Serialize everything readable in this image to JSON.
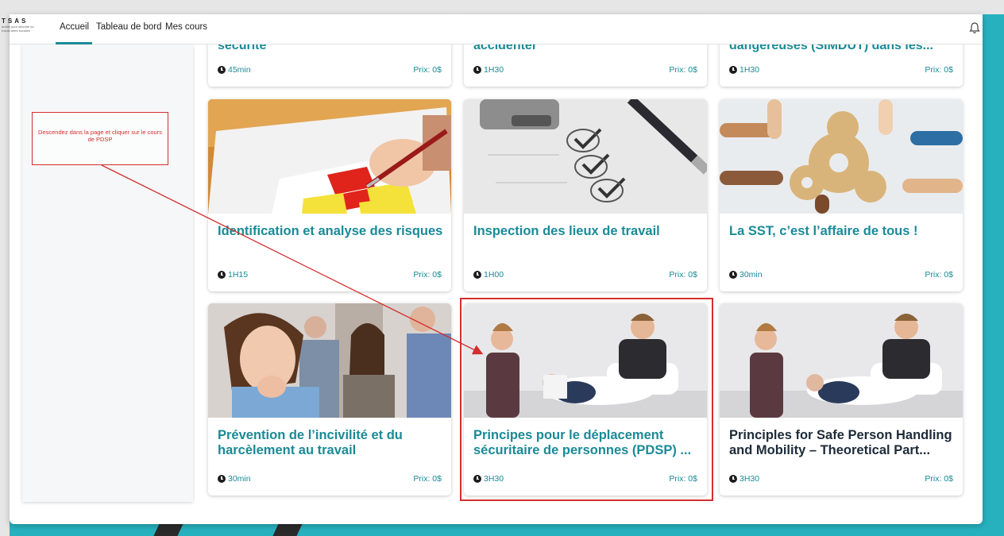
{
  "nav": {
    "brand": "TSAS",
    "brand_sub": "ariatie pour sécurité du travail aires sociales",
    "links": [
      "Accueil",
      "Tableau de bord",
      "Mes cours"
    ]
  },
  "annotation": {
    "text": "Descendez dans la page et cliquer sur le cours de PDSP"
  },
  "courses_top": [
    {
      "title": "sécurité",
      "duration": "45min",
      "price": "Prix: 0$"
    },
    {
      "title": "accidenter",
      "duration": "1H30",
      "price": "Prix: 0$"
    },
    {
      "title": "dangereuses (SIMDUT) dans les...",
      "duration": "1H30",
      "price": "Prix: 0$"
    }
  ],
  "courses": [
    {
      "title": "Identification et analyse des risques",
      "duration": "1H15",
      "price": "Prix: 0$"
    },
    {
      "title": "Inspection des lieux de travail",
      "duration": "1H00",
      "price": "Prix: 0$"
    },
    {
      "title": "La SST, c’est l’affaire de tous !",
      "duration": "30min",
      "price": "Prix: 0$"
    },
    {
      "title": "Prévention de l’incivilité et du harcèlement au travail",
      "duration": "30min",
      "price": "Prix: 0$"
    },
    {
      "title": "Principes pour le déplacement sécuritaire de personnes (PDSP) ...",
      "duration": "3H30",
      "price": "Prix: 0$"
    },
    {
      "title": "Principles for Safe Person Handling and Mobility – Theoretical Part...",
      "duration": "3H30",
      "price": "Prix: 0$"
    }
  ],
  "colors": {
    "accent": "#1a8a97",
    "teal_bg": "#27b1bf",
    "annotation": "#d32f2f"
  }
}
